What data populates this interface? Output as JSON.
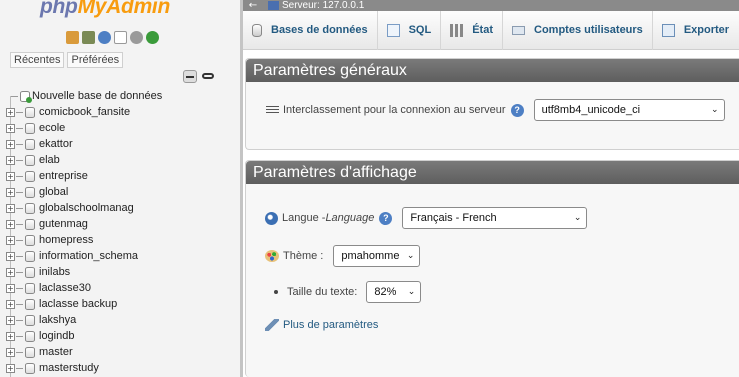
{
  "nav": {
    "logo": {
      "php": "php",
      "my": "My",
      "admin": "Admin"
    },
    "icons": [
      "home-icon",
      "database-icon",
      "help-icon",
      "docs-icon",
      "settings-icon",
      "reload-icon"
    ],
    "tabs": {
      "recent": "Récentes",
      "favorites": "Préférées"
    },
    "new_db_label": "Nouvelle base de données",
    "databases": [
      "comicbook_fansite",
      "ecole",
      "ekattor",
      "elab",
      "entreprise",
      "global",
      "globalschoolmanag",
      "gutenmag",
      "homepress",
      "information_schema",
      "inilabs",
      "laclasse30",
      "laclasse backup",
      "lakshya",
      "logindb",
      "master",
      "masterstudy"
    ]
  },
  "topbar": {
    "back": "←",
    "server": "Serveur: 127.0.0.1"
  },
  "menu": [
    {
      "label": "Bases de données",
      "icon": "database-icon"
    },
    {
      "label": "SQL",
      "icon": "sql-icon"
    },
    {
      "label": "État",
      "icon": "status-icon"
    },
    {
      "label": "Comptes utilisateurs",
      "icon": "users-icon"
    },
    {
      "label": "Exporter",
      "icon": "export-icon"
    }
  ],
  "general": {
    "title": "Paramètres généraux",
    "collation_label": "Interclassement pour la connexion au serveur",
    "collation_value": "utf8mb4_unicode_ci"
  },
  "display": {
    "title": "Paramètres d'affichage",
    "lang_label": "Langue - ",
    "lang_label_italic": "Language",
    "lang_value": "Français - French",
    "theme_label": "Thème :",
    "theme_value": "pmahomme",
    "textsize_label": "Taille du texte:",
    "textsize_value": "82%",
    "more_settings": "Plus de paramètres"
  },
  "colors": {
    "accent": "#235a81",
    "legend_bg": "#6b6b6b",
    "logo_orange": "#f89c0e",
    "logo_blue": "#6c78af"
  }
}
